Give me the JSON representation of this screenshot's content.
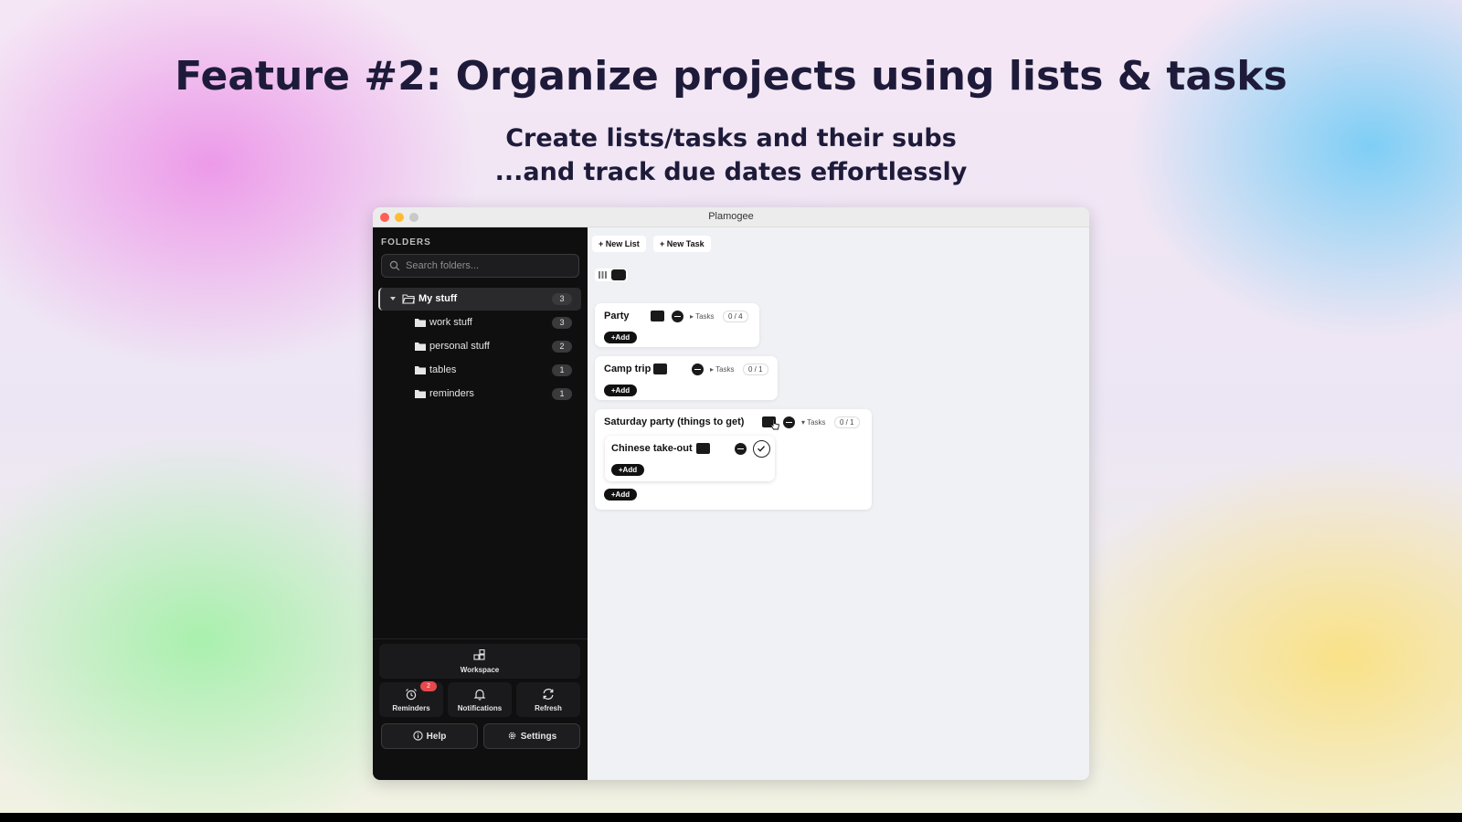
{
  "page": {
    "headline": "Feature #2: Organize projects using lists & tasks",
    "subline1": "Create lists/tasks and their subs",
    "subline2": "...and track due dates effortlessly"
  },
  "window": {
    "title": "Plamogee"
  },
  "sidebar": {
    "folders_label": "FOLDERS",
    "search": {
      "placeholder": "Search folders..."
    },
    "folders": [
      {
        "label": "My stuff",
        "count": "3",
        "active": true
      },
      {
        "label": "work stuff",
        "count": "3"
      },
      {
        "label": "personal stuff",
        "count": "2"
      },
      {
        "label": "tables",
        "count": "1"
      },
      {
        "label": "reminders",
        "count": "1"
      }
    ],
    "workspace_label": "Workspace",
    "reminders": {
      "label": "Reminders",
      "badge": "2"
    },
    "notifications_label": "Notifications",
    "refresh_label": "Refresh",
    "help_label": "Help",
    "settings_label": "Settings"
  },
  "main": {
    "new_list_label": "+ New List",
    "new_task_label": "+ New Task",
    "lists": [
      {
        "title": "Party",
        "tasks_label": "▸ Tasks",
        "ratio": "0 / 4",
        "add_label": "+Add"
      },
      {
        "title": "Camp trip",
        "tasks_label": "▸ Tasks",
        "ratio": "0 / 1",
        "add_label": "+Add"
      },
      {
        "title": "Saturday party (things to get)",
        "tasks_label": "▾ Tasks",
        "ratio": "0 / 1",
        "add_label": "+Add",
        "subtask": {
          "title": "Chinese take-out",
          "add_label": "+Add"
        }
      }
    ]
  },
  "colors": {
    "sidebar_bg": "#0f0f10",
    "main_bg": "#f0f1f4",
    "badge_red": "#e5484d",
    "heading": "#1e1b3a"
  }
}
